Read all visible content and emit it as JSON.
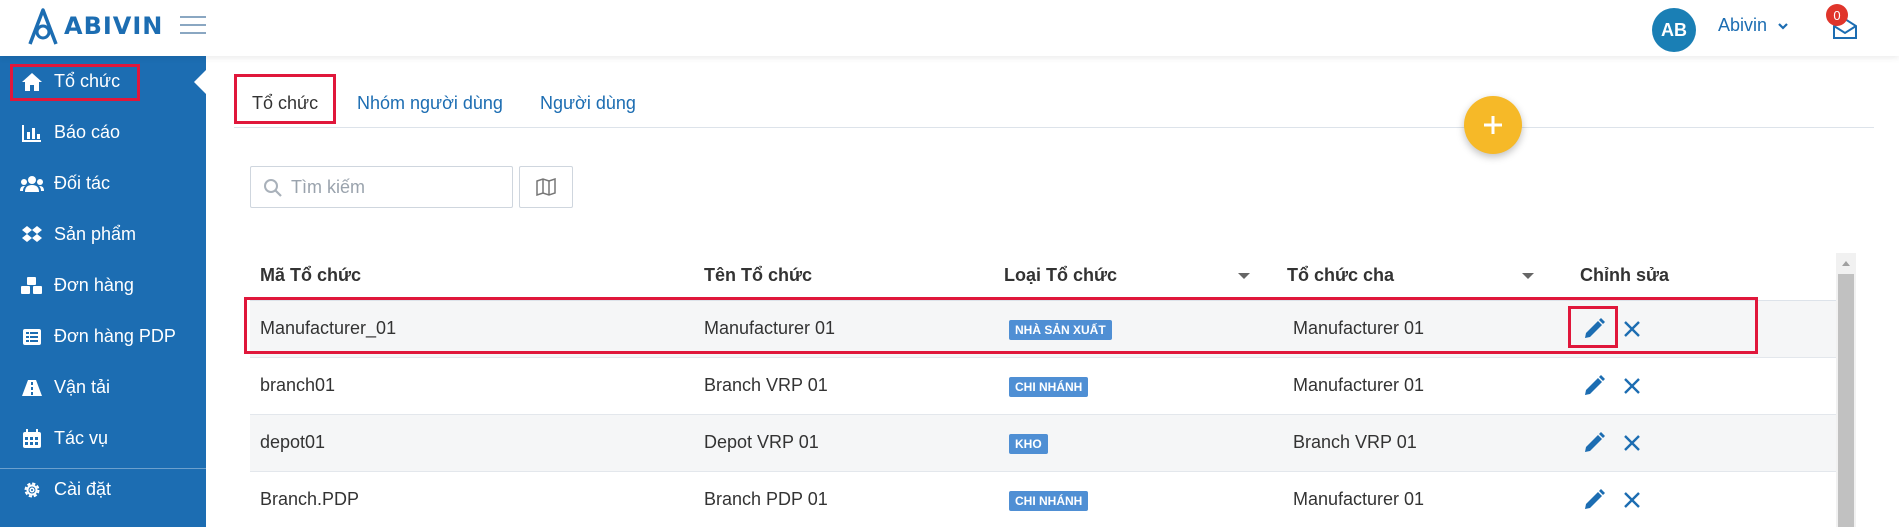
{
  "brand": {
    "name": "ABIVIN"
  },
  "header": {
    "avatar_initials": "AB",
    "username": "Abivin",
    "notification_count": "0"
  },
  "sidebar": {
    "items": [
      {
        "label": "Tổ chức",
        "icon": "home-icon"
      },
      {
        "label": "Báo cáo",
        "icon": "bar-chart-icon"
      },
      {
        "label": "Đối tác",
        "icon": "users-icon"
      },
      {
        "label": "Sản phẩm",
        "icon": "dropbox-icon"
      },
      {
        "label": "Đơn hàng",
        "icon": "cubes-icon"
      },
      {
        "label": "Đơn hàng PDP",
        "icon": "list-icon"
      },
      {
        "label": "Vận tải",
        "icon": "road-icon"
      },
      {
        "label": "Tác vụ",
        "icon": "calendar-icon"
      },
      {
        "label": "Cài đặt",
        "icon": "gear-icon"
      }
    ]
  },
  "tabs": [
    {
      "label": "Tổ chức"
    },
    {
      "label": "Nhóm người dùng"
    },
    {
      "label": "Người dùng"
    }
  ],
  "search": {
    "placeholder": "Tìm kiếm"
  },
  "table": {
    "headers": [
      "Mã Tổ chức",
      "Tên Tổ chức",
      "Loại Tổ chức",
      "Tổ chức cha",
      "Chỉnh sửa"
    ],
    "rows": [
      {
        "code": "Manufacturer_01",
        "name": "Manufacturer 01",
        "type": "NHÀ SẢN XUẤT",
        "parent": "Manufacturer 01"
      },
      {
        "code": "branch01",
        "name": "Branch VRP 01",
        "type": "CHI NHÁNH",
        "parent": "Manufacturer 01"
      },
      {
        "code": "depot01",
        "name": "Depot VRP 01",
        "type": "KHO",
        "parent": "Branch VRP 01"
      },
      {
        "code": "Branch.PDP",
        "name": "Branch PDP 01",
        "type": "CHI NHÁNH",
        "parent": "Manufacturer 01"
      }
    ]
  },
  "colors": {
    "primary": "#1c6db2",
    "accent": "#f6b928",
    "highlight": "#e0173b",
    "tag": "#4f8fd4"
  }
}
